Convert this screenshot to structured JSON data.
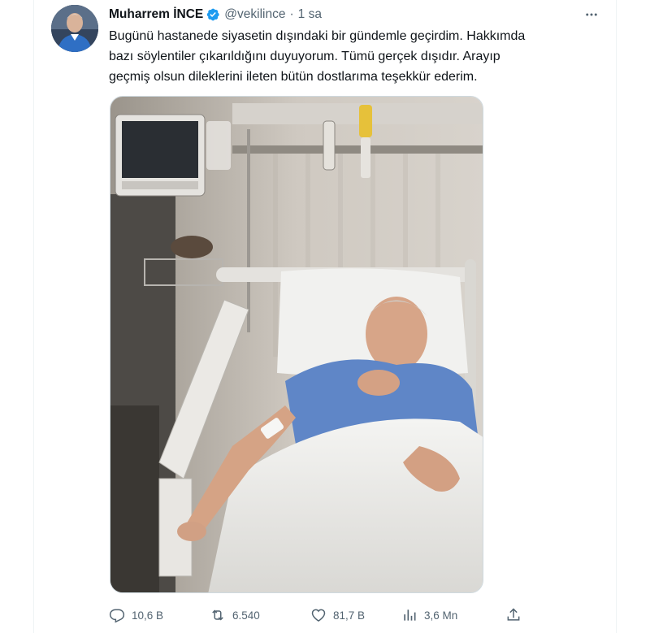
{
  "tweet": {
    "author": {
      "display_name": "Muharrem İNCE",
      "handle": "@vekilince",
      "verified": true,
      "avatar_icon": "profile-photo"
    },
    "separator": "·",
    "time": "1 sa",
    "text_lines": [
      "Bugünü hastanede siyasetin dışındaki bir gündemle geçirdim. Hakkımda",
      "bazı söylentiler çıkarıldığını duyuyorum. Tümü gerçek dışıdır. Arayıp",
      "geçmiş olsun dileklerini ileten bütün dostlarıma teşekkür ederim."
    ],
    "media": {
      "type": "photo",
      "icon": "hospital-bed-photo"
    },
    "actions": {
      "reply": {
        "icon": "reply-icon",
        "count": "10,6 B"
      },
      "retweet": {
        "icon": "retweet-icon",
        "count": "6.540"
      },
      "like": {
        "icon": "heart-icon",
        "count": "81,7 B"
      },
      "views": {
        "icon": "views-icon",
        "count": "3,6 Mn"
      },
      "share": {
        "icon": "share-icon"
      }
    }
  },
  "colors": {
    "text_primary": "#0f1419",
    "text_secondary": "#536471",
    "verified_blue": "#1d9bf0",
    "border": "#cfd9de"
  }
}
